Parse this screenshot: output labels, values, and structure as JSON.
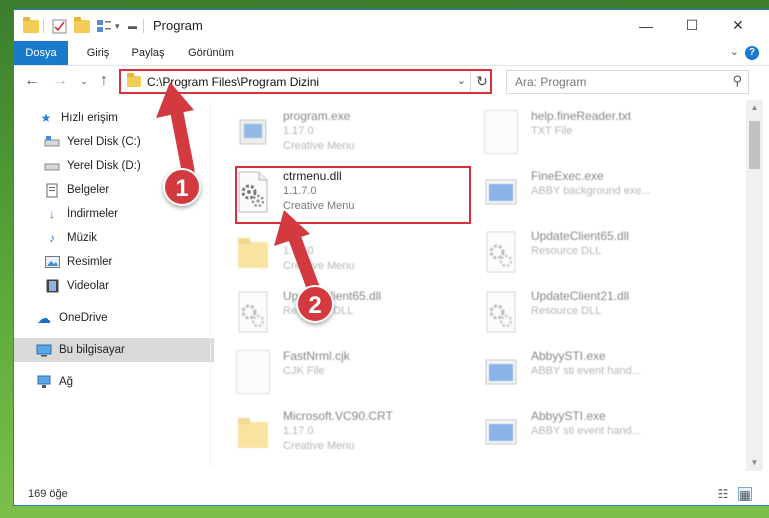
{
  "window": {
    "title": "Program",
    "controls": {
      "minimize": "—",
      "maximize": "☐",
      "close": "✕"
    }
  },
  "ribbon": {
    "tabs": [
      "Dosya",
      "Giriş",
      "Paylaş",
      "Görünüm"
    ],
    "help": "?"
  },
  "address": {
    "path": "C:\\Program Files\\Program Dizini",
    "search_placeholder": "Ara: Program"
  },
  "sidebar": {
    "items": [
      {
        "label": "Hızlı erişim",
        "icon": "star-icon"
      },
      {
        "label": "Yerel Disk (C:)",
        "icon": "drive-icon",
        "pinned": true
      },
      {
        "label": "Yerel Disk (D:)",
        "icon": "drive-icon",
        "pinned": true
      },
      {
        "label": "Belgeler",
        "icon": "documents-icon",
        "pinned": true
      },
      {
        "label": "İndirmeler",
        "icon": "download-icon",
        "pinned": true
      },
      {
        "label": "Müzik",
        "icon": "music-icon",
        "pinned": true
      },
      {
        "label": "Resimler",
        "icon": "pictures-icon",
        "pinned": true
      },
      {
        "label": "Videolar",
        "icon": "videos-icon",
        "pinned": true
      },
      {
        "label": "OneDrive",
        "icon": "cloud-icon"
      },
      {
        "label": "Bu bilgisayar",
        "icon": "computer-icon",
        "selected": true
      },
      {
        "label": "Ağ",
        "icon": "network-icon"
      }
    ]
  },
  "files": [
    {
      "name": "program.exe",
      "line1": "1.17.0",
      "line2": "Creative Menu",
      "icon": "exe-icon"
    },
    {
      "name": "help.fineReader.txt",
      "line1": "TXT File",
      "line2": "",
      "icon": "text-file-icon"
    },
    {
      "name": "ctrmenu.dll",
      "line1": "1.1.7.0",
      "line2": "Creative Menu",
      "icon": "dll-gear-icon"
    },
    {
      "name": "FineExec.exe",
      "line1": "ABBY background exe...",
      "line2": "",
      "icon": "exe-window-icon"
    },
    {
      "name": "",
      "line1": "1.17.0",
      "line2": "Creative Menu",
      "icon": "folder-icon"
    },
    {
      "name": "UpdateClient65.dll",
      "line1": "Resource DLL",
      "line2": "",
      "icon": "dll-gear-icon"
    },
    {
      "name": "UpdateClient65.dll",
      "line1": "Resource DLL",
      "line2": "",
      "icon": "dll-gear-icon"
    },
    {
      "name": "UpdateClient21.dll",
      "line1": "Resource DLL",
      "line2": "",
      "icon": "dll-gear-icon"
    },
    {
      "name": "FastNrml.cjk",
      "line1": "CJK File",
      "line2": "",
      "icon": "blank-file-icon"
    },
    {
      "name": "AbbyySTI.exe",
      "line1": "ABBY sti event hand...",
      "line2": "",
      "icon": "exe-window-icon"
    },
    {
      "name": "Microsoft.VC90.CRT",
      "line1": "1.17.0",
      "line2": "Creative Menu",
      "icon": "folder-icon"
    },
    {
      "name": "AbbyySTI.exe",
      "line1": "ABBY sti event hand...",
      "line2": "",
      "icon": "exe-window-icon"
    }
  ],
  "status": {
    "item_count": "169 öğe"
  },
  "annotations": {
    "step1": "1",
    "step2": "2"
  },
  "colors": {
    "accent": "#1979ca",
    "highlight": "#d9303a",
    "badge": "#d33a3f"
  }
}
